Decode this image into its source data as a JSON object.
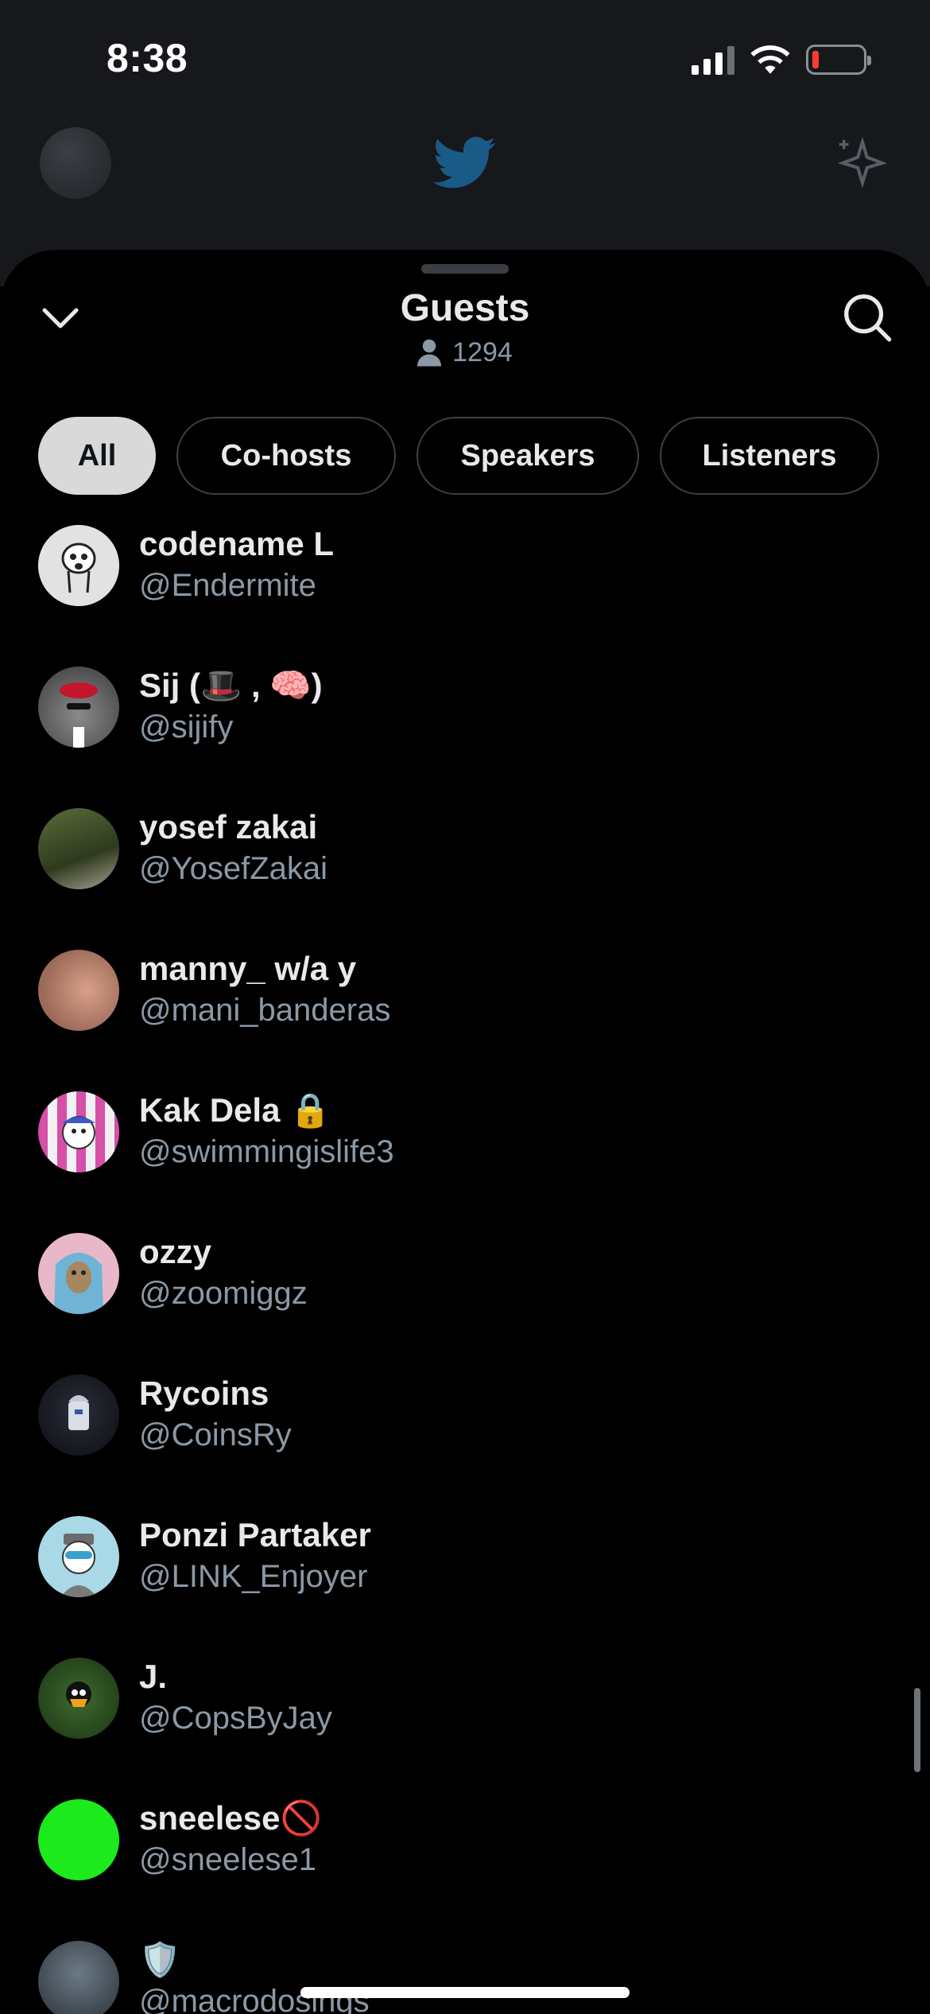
{
  "status_bar": {
    "time": "8:38"
  },
  "sheet": {
    "title": "Guests",
    "listener_count": "1294"
  },
  "tabs": [
    {
      "label": "All",
      "active": true
    },
    {
      "label": "Co-hosts",
      "active": false
    },
    {
      "label": "Speakers",
      "active": false
    },
    {
      "label": "Listeners",
      "active": false
    }
  ],
  "guests": [
    {
      "name": "codename L",
      "handle": "@Endermite"
    },
    {
      "name": "Sij (🎩 , 🧠)",
      "handle": "@sijify"
    },
    {
      "name": "yosef zakai",
      "handle": "@YosefZakai"
    },
    {
      "name": "manny_ w/a y",
      "handle": "@mani_banderas"
    },
    {
      "name": "Kak Dela 🔒",
      "handle": "@swimmingislife3"
    },
    {
      "name": "ozzy",
      "handle": "@zoomiggz"
    },
    {
      "name": "Rycoins",
      "handle": "@CoinsRy"
    },
    {
      "name": "Ponzi Partaker",
      "handle": "@LINK_Enjoyer"
    },
    {
      "name": "J.",
      "handle": "@CopsByJay"
    },
    {
      "name": "sneelese🚫",
      "handle": "@sneelese1"
    },
    {
      "name": "🛡️",
      "handle": "@macrodosings"
    }
  ],
  "colors": {
    "accent_bg": "#000000",
    "active_tab": "#d9d9d9",
    "secondary_text": "#8b98a5"
  }
}
